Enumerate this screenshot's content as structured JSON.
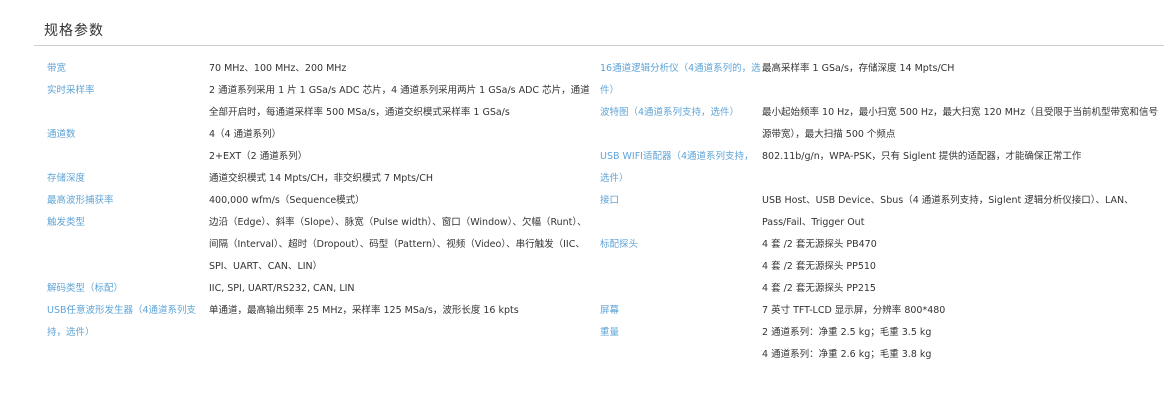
{
  "section_title": "规格参数",
  "left_specs": [
    {
      "label": "带宽",
      "values": [
        "70 MHz、100 MHz、200 MHz"
      ]
    },
    {
      "label": "实时采样率",
      "values": [
        "2 通道系列采用 1 片 1 GSa/s ADC 芯片，4 通道系列采用两片 1 GSa/s ADC 芯片，通道全部开启时，每通道采样率 500 MSa/s，通道交织模式采样率 1 GSa/s"
      ]
    },
    {
      "label": "通道数",
      "values": [
        "4（4 通道系列）",
        "2+EXT（2 通道系列）"
      ]
    },
    {
      "label": "存储深度",
      "values": [
        "通道交织模式 14 Mpts/CH，非交织模式 7 Mpts/CH"
      ]
    },
    {
      "label": "最高波形捕获率",
      "values": [
        "400,000 wfm/s（Sequence模式）"
      ]
    },
    {
      "label": "触发类型",
      "values": [
        "边沿（Edge）、斜率（Slope）、脉宽（Pulse width）、窗口（Window）、欠幅（Runt）、间隔（Interval）、超时（Dropout）、码型（Pattern）、视频（Video）、串行触发（IIC、SPI、UART、CAN、LIN）"
      ]
    },
    {
      "label": "解码类型（标配）",
      "values": [
        "IIC, SPI, UART/RS232, CAN, LIN"
      ]
    },
    {
      "label": "USB任意波形发生器（4通道系列支持，选件）",
      "values": [
        "单通道，最高输出频率 25 MHz，采样率 125 MSa/s，波形长度 16 kpts"
      ]
    }
  ],
  "right_specs": [
    {
      "label": "16通道逻辑分析仪（4通道系列的，选件）",
      "values": [
        "最高采样率 1 GSa/s，存储深度 14 Mpts/CH"
      ]
    },
    {
      "label": "波特图（4通道系列支持，选件）",
      "values": [
        "最小起始频率 10 Hz，最小扫宽 500 Hz，最大扫宽 120 MHz（且受限于当前机型带宽和信号源带宽），最大扫描 500 个频点"
      ]
    },
    {
      "label": "USB WIFI适配器（4通道系列支持，选件）",
      "values": [
        "802.11b/g/n，WPA-PSK，只有 Siglent 提供的适配器，才能确保正常工作"
      ]
    },
    {
      "label": "接口",
      "values": [
        "USB Host、USB Device、Sbus（4 通道系列支持，Siglent 逻辑分析仪接口）、LAN、Pass/Fail、Trigger Out"
      ]
    },
    {
      "label": "标配探头",
      "values": [
        "4 套 /2 套无源探头 PB470",
        "4 套 /2 套无源探头 PP510",
        "4 套 /2 套无源探头 PP215"
      ]
    },
    {
      "label": "屏幕",
      "values": [
        "7 英寸 TFT-LCD 显示屏，分辨率 800*480"
      ]
    },
    {
      "label": "重量",
      "values": [
        "2 通道系列：净重 2.5 kg；毛重 3.5 kg",
        "4 通道系列：净重 2.6 kg；毛重 3.8 kg"
      ]
    }
  ],
  "colors": {
    "label": "#5fa4d6",
    "text": "#333333",
    "rule": "#cfcfcf"
  }
}
